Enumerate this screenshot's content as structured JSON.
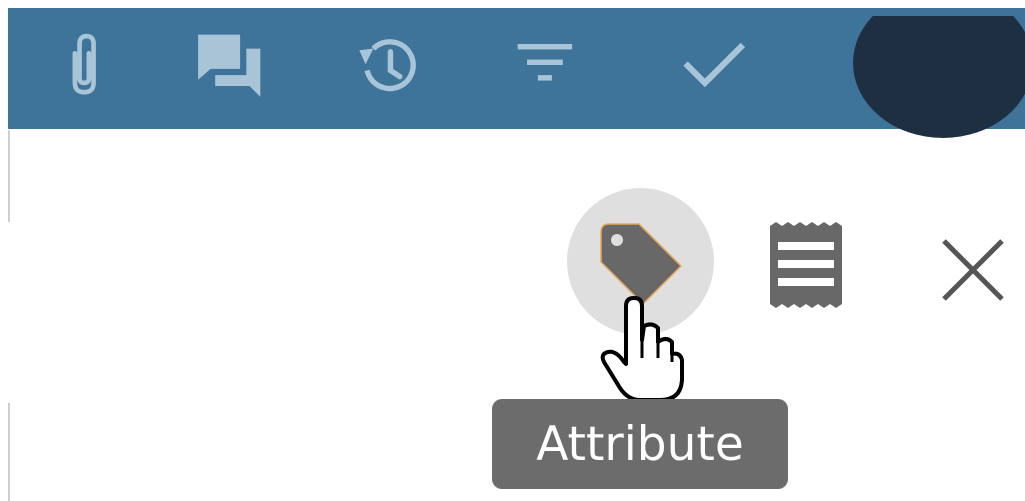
{
  "toolbar": {
    "background": "#3e7499",
    "icon_color": "#a9c4d7",
    "icons": [
      "paperclip-icon",
      "comments-icon",
      "history-icon",
      "filter-icon",
      "check-icon"
    ]
  },
  "actions": {
    "attribute_icon": "tag-icon",
    "notes_icon": "receipt-icon",
    "close_icon": "close-icon",
    "hover_background": "#dfdfdf"
  },
  "tooltip": {
    "text": "Attribute",
    "background": "#6c6c6c"
  }
}
